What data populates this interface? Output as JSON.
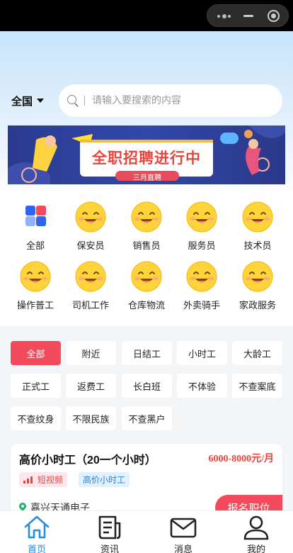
{
  "search": {
    "region": "全国",
    "placeholder": "请输入要搜索的内容"
  },
  "banner": {
    "headline": "全职招聘进行中",
    "sub": "三月直聘"
  },
  "categories": [
    {
      "label": "全部",
      "icon": "grid-icon"
    },
    {
      "label": "保安员",
      "icon": "smiley-icon"
    },
    {
      "label": "销售员",
      "icon": "smiley-icon"
    },
    {
      "label": "服务员",
      "icon": "smiley-icon"
    },
    {
      "label": "技术员",
      "icon": "smiley-icon"
    },
    {
      "label": "操作普工",
      "icon": "smiley-icon"
    },
    {
      "label": "司机工作",
      "icon": "smiley-icon"
    },
    {
      "label": "仓库物流",
      "icon": "smiley-icon"
    },
    {
      "label": "外卖骑手",
      "icon": "smiley-icon"
    },
    {
      "label": "家政服务",
      "icon": "smiley-icon"
    }
  ],
  "filters": [
    {
      "label": "全部",
      "active": true
    },
    {
      "label": "附近",
      "active": false
    },
    {
      "label": "日结工",
      "active": false
    },
    {
      "label": "小时工",
      "active": false
    },
    {
      "label": "大龄工",
      "active": false
    },
    {
      "label": "正式工",
      "active": false
    },
    {
      "label": "返费工",
      "active": false
    },
    {
      "label": "长白班",
      "active": false
    },
    {
      "label": "不体验",
      "active": false
    },
    {
      "label": "不查案底",
      "active": false
    },
    {
      "label": "不查纹身",
      "active": false
    },
    {
      "label": "不限民族",
      "active": false
    },
    {
      "label": "不查黑户",
      "active": false
    }
  ],
  "job": {
    "title": "高价小时工（20一个小时）",
    "salary": "6000-8000元/月",
    "tags": [
      "短视频",
      "高价小时工"
    ],
    "company": "嘉兴天通电子",
    "apply_label": "报名职位"
  },
  "tabbar": [
    {
      "label": "首页",
      "icon": "home-icon",
      "active": true
    },
    {
      "label": "资讯",
      "icon": "news-icon",
      "active": false
    },
    {
      "label": "消息",
      "icon": "mail-icon",
      "active": false
    },
    {
      "label": "我的",
      "icon": "user-icon",
      "active": false
    }
  ],
  "colors": {
    "accent_red": "#f44b5c",
    "tab_active_blue": "#2a8ae0",
    "salary_red": "#e8453c",
    "location_green": "#19b56a"
  }
}
